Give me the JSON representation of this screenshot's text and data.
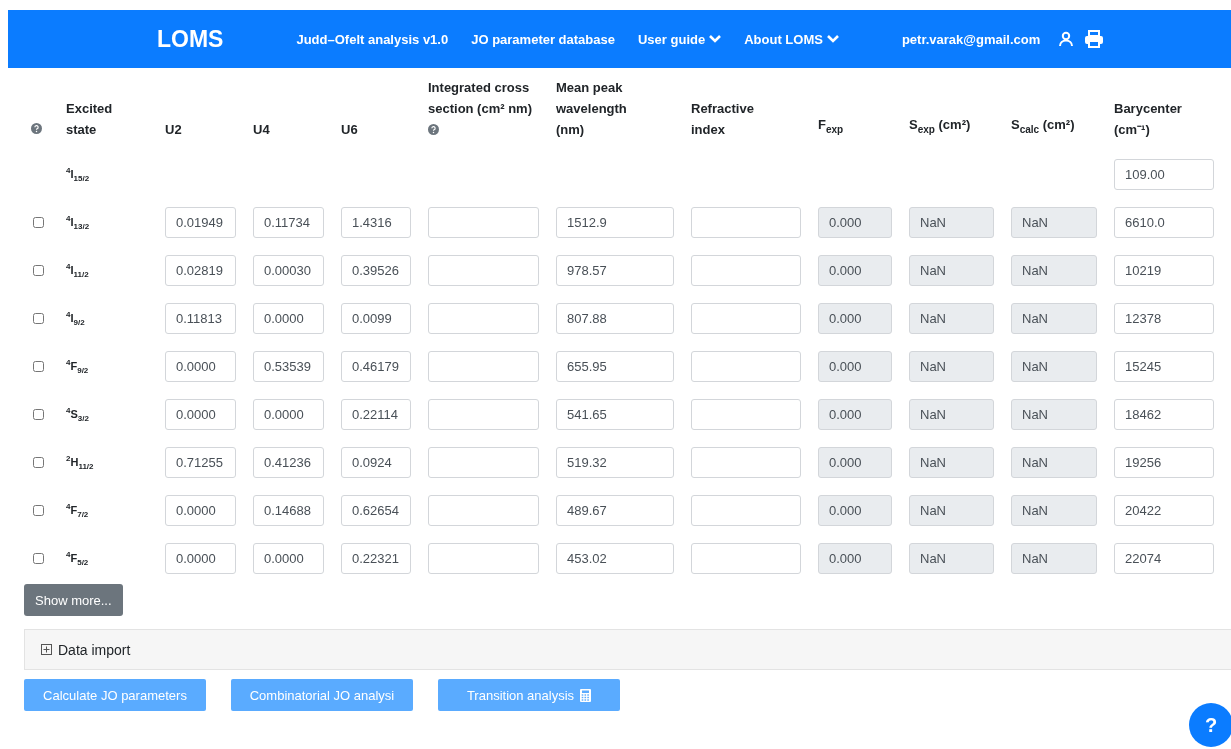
{
  "navbar": {
    "brand": "LOMS",
    "links": [
      {
        "label": "Judd–Ofelt analysis v1.0",
        "dropdown": false
      },
      {
        "label": "JO parameter database",
        "dropdown": false
      },
      {
        "label": "User guide",
        "dropdown": true
      },
      {
        "label": "About LOMS",
        "dropdown": true
      }
    ],
    "user": "petr.varak@gmail.com"
  },
  "table": {
    "columns": [
      {
        "label": "Excited state",
        "kind": "state"
      },
      {
        "label": "U2",
        "kind": "input"
      },
      {
        "label": "U4",
        "kind": "input"
      },
      {
        "label": "U6",
        "kind": "input"
      },
      {
        "label": "Integrated cross section (cm² nm)",
        "kind": "input",
        "help": true
      },
      {
        "label": "Mean peak wavelength (nm)",
        "kind": "input"
      },
      {
        "label": "Refractive index",
        "kind": "input"
      },
      {
        "label": "F$_{exp}$",
        "kind": "readonly"
      },
      {
        "label": "S$_{exp}$ (cm²)",
        "kind": "readonly"
      },
      {
        "label": "S$_{calc}$ (cm²)",
        "kind": "readonly"
      },
      {
        "label": "Barycenter (cm⁻¹)",
        "kind": "input"
      }
    ],
    "rows": [
      {
        "cells": [
          "$^{4}$I$_{15/2}$",
          null,
          null,
          null,
          null,
          null,
          null,
          null,
          null,
          null,
          "109.00"
        ]
      },
      {
        "checked": false,
        "cells": [
          "$^{4}$I$_{13/2}$",
          "0.01949",
          "0.11734",
          "1.4316",
          "",
          "1512.9",
          "",
          "0.000",
          "NaN",
          "NaN",
          "6610.0"
        ]
      },
      {
        "checked": false,
        "cells": [
          "$^{4}$I$_{11/2}$",
          "0.02819",
          "0.00030",
          "0.39526",
          "",
          "978.57",
          "",
          "0.000",
          "NaN",
          "NaN",
          "10219"
        ]
      },
      {
        "checked": false,
        "cells": [
          "$^{4}$I$_{9/2}$",
          "0.11813",
          "0.0000",
          "0.0099",
          "",
          "807.88",
          "",
          "0.000",
          "NaN",
          "NaN",
          "12378"
        ]
      },
      {
        "checked": false,
        "cells": [
          "$^{4}$F$_{9/2}$",
          "0.0000",
          "0.53539",
          "0.46179",
          "",
          "655.95",
          "",
          "0.000",
          "NaN",
          "NaN",
          "15245"
        ]
      },
      {
        "checked": false,
        "cells": [
          "$^{4}$S$_{3/2}$",
          "0.0000",
          "0.0000",
          "0.22114",
          "",
          "541.65",
          "",
          "0.000",
          "NaN",
          "NaN",
          "18462"
        ]
      },
      {
        "checked": false,
        "cells": [
          "$^{2}$H$_{11/2}$",
          "0.71255",
          "0.41236",
          "0.0924",
          "",
          "519.32",
          "",
          "0.000",
          "NaN",
          "NaN",
          "19256"
        ]
      },
      {
        "checked": false,
        "cells": [
          "$^{4}$F$_{7/2}$",
          "0.0000",
          "0.14688",
          "0.62654",
          "",
          "489.67",
          "",
          "0.000",
          "NaN",
          "NaN",
          "20422"
        ]
      },
      {
        "checked": false,
        "cells": [
          "$^{4}$F$_{5/2}$",
          "0.0000",
          "0.0000",
          "0.22321",
          "",
          "453.02",
          "",
          "0.000",
          "NaN",
          "NaN",
          "22074"
        ]
      }
    ]
  },
  "show_more": "Show more...",
  "data_import": {
    "label": "Data import",
    "expanded": false
  },
  "actions": [
    {
      "label": "Calculate JO parameters",
      "icon": false
    },
    {
      "label": "Combinatorial JO analysi",
      "icon": false
    },
    {
      "label": "Transition analysis",
      "icon": true
    }
  ],
  "help_button": "?"
}
